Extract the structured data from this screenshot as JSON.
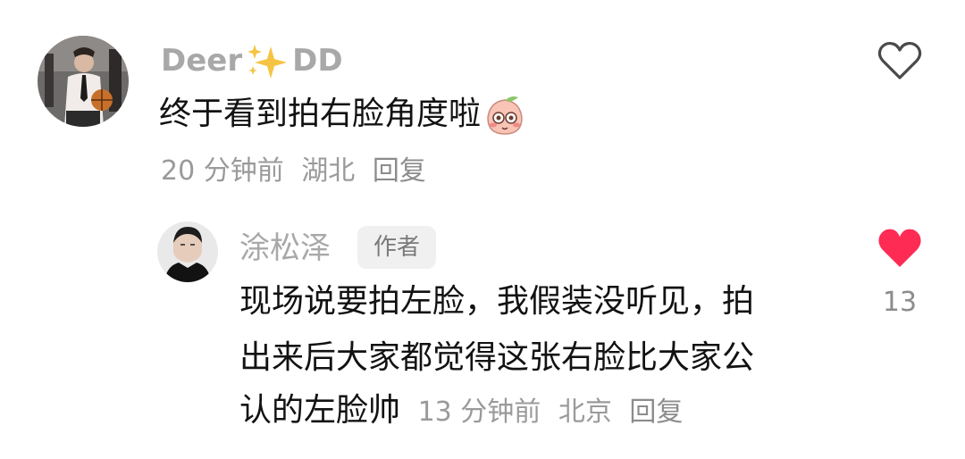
{
  "comment": {
    "username_prefix": "Deer",
    "username_suffix": "DD",
    "text": "终于看到拍右脸角度啦",
    "meta": {
      "time": "20 分钟前",
      "location": "湖北",
      "reply_label": "回复"
    },
    "liked": false
  },
  "reply": {
    "username": "涂松泽",
    "badge": "作者",
    "text_lines": [
      "现场说要拍左脸，我假装没听见，拍",
      "出来后大家都觉得这张右脸比大家公",
      "认的左脸帅"
    ],
    "meta": {
      "time": "13 分钟前",
      "location": "北京",
      "reply_label": "回复"
    },
    "liked": true,
    "like_count": "13"
  },
  "colors": {
    "username": "#a8a8a8",
    "like_active": "#fe2c55",
    "meta": "#9a9a9a"
  }
}
